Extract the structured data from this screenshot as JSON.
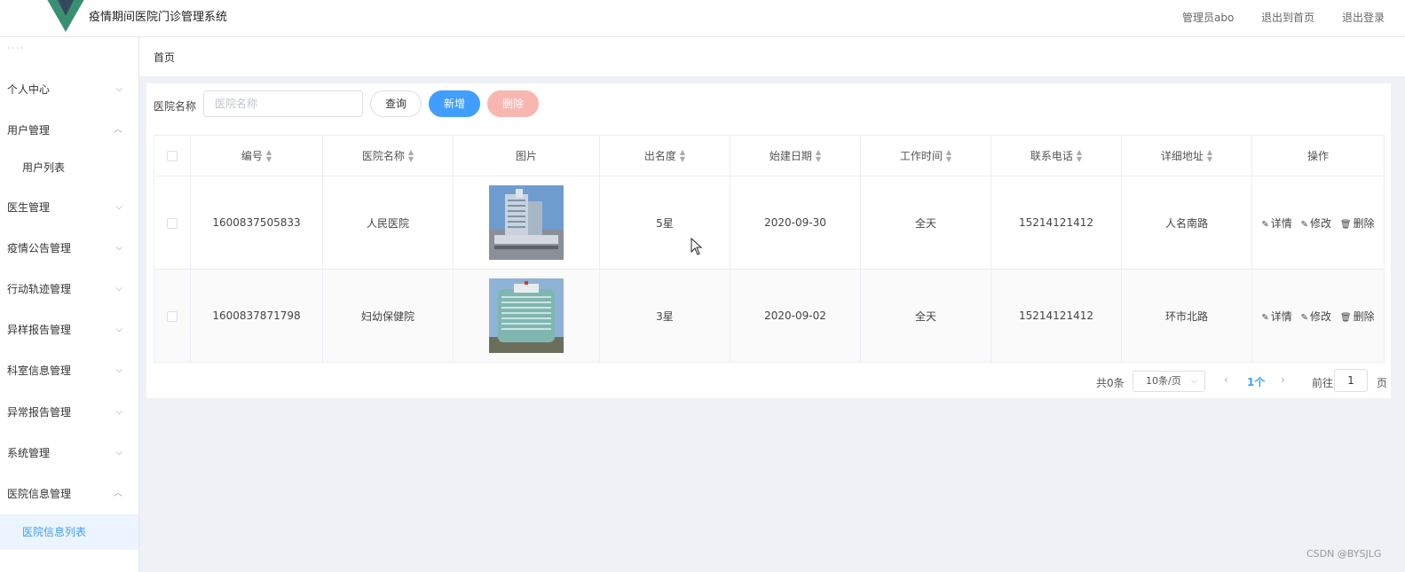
{
  "header": {
    "title": "疫情期间医院门诊管理系统",
    "nav": [
      "管理员abo",
      "退出到首页",
      "退出登录"
    ]
  },
  "sidebar": {
    "dots": "· · · ·",
    "items": [
      {
        "label": "个人中心"
      },
      {
        "label": "用户管理"
      },
      {
        "label": "用户列表"
      },
      {
        "label": "医生管理"
      },
      {
        "label": "疫情公告管理"
      },
      {
        "label": "行动轨迹管理"
      },
      {
        "label": "异样报告管理"
      },
      {
        "label": "科室信息管理"
      },
      {
        "label": "异常报告管理"
      },
      {
        "label": "系统管理"
      },
      {
        "label": "医院信息管理"
      },
      {
        "label": "医院信息列表"
      }
    ]
  },
  "breadcrumb": "首页",
  "search": {
    "label": "医院名称",
    "placeholder": "医院名称",
    "query_button": "查询",
    "add_button": "新增",
    "delete_button": "删除"
  },
  "table": {
    "headers": [
      "编号",
      "医院名称",
      "图片",
      "出名度",
      "始建日期",
      "工作时间",
      "联系电话",
      "详细地址",
      "操作"
    ],
    "rows": [
      {
        "id": "1600837505833",
        "name": "人民医院",
        "fame": "5星",
        "date": "2020-09-30",
        "hours": "全天",
        "phone": "15214121412",
        "address": "人名南路"
      },
      {
        "id": "1600837871798",
        "name": "妇幼保健院",
        "fame": "3星",
        "date": "2020-09-02",
        "hours": "全天",
        "phone": "15214121412",
        "address": "环市北路"
      }
    ],
    "actions": [
      "详情",
      "修改",
      "删除"
    ]
  },
  "pagination": {
    "total": "共0条",
    "page_size": "10条/页",
    "current": "1个",
    "goto_label": "前往",
    "goto_value": "1",
    "page_suffix": "页"
  },
  "watermark": "CSDN @BYSJLG",
  "colors": {
    "primary": "#409eff",
    "danger_light": "#f8b6b1",
    "logo_green": "#2f7d62",
    "background": "#eef1f5"
  }
}
